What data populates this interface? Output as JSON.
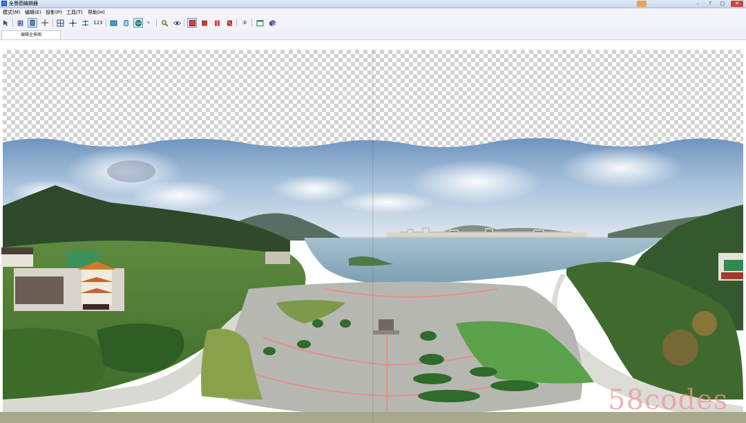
{
  "window": {
    "title": "全景图编辑器"
  },
  "menu": [
    "模式(M)",
    "编辑(E)",
    "投影(P)",
    "工具(T)",
    "帮助(H)"
  ],
  "toolbar": {
    "icons": [
      "select-arrow-icon",
      "rotate-view-icon",
      "hand-pan-icon",
      "crosshair-icon",
      "fit-view-icon",
      "control-points-icon",
      "align-icon",
      "number-label-icon",
      "image-icon",
      "cylinder-icon",
      "globe-icon",
      "dropdown-arrow-icon",
      "magnifier-icon",
      "eye-icon",
      "flag-red-1-icon",
      "flag-red-2-icon",
      "flag-red-3-icon",
      "flag-red-4-icon",
      "circled-3-icon",
      "window-icon",
      "export-icon"
    ],
    "number_label": "123",
    "circled_label": "③"
  },
  "tab": {
    "label": "编辑全景图"
  },
  "watermark": "58codes",
  "colors": {
    "titlebar": "#c7d8ee",
    "toolbar": "#f1f3f8",
    "active_tool": "#dde7f7"
  }
}
